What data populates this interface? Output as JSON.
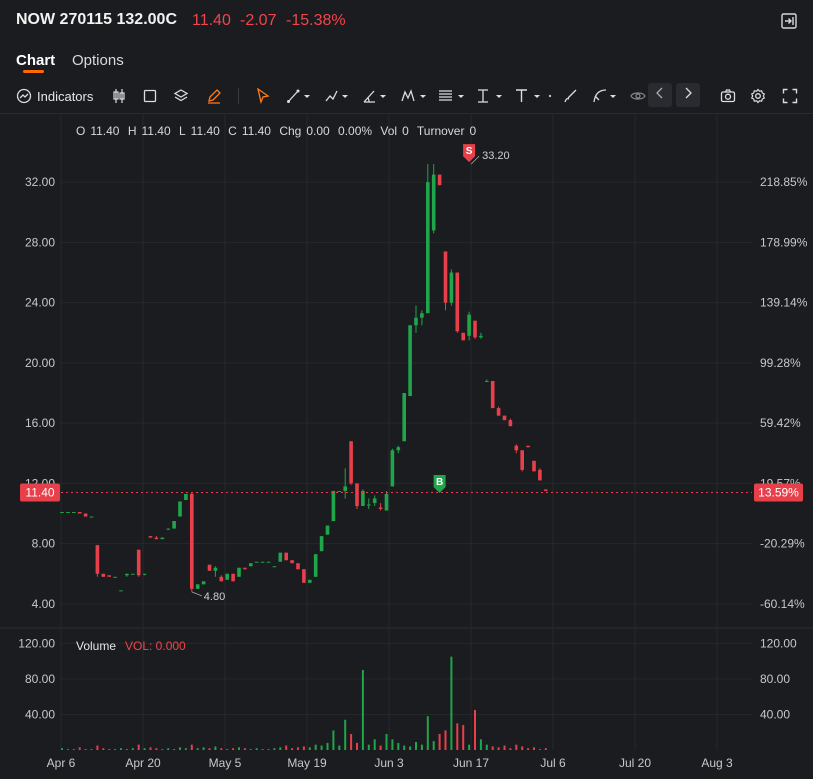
{
  "header": {
    "symbol": "NOW 270115 132.00C",
    "last_price": "11.40",
    "change": "-2.07",
    "change_pct": "-15.38%",
    "exit_icon": "exit-fullscreen-icon"
  },
  "tabs": [
    {
      "label": "Chart",
      "active": true
    },
    {
      "label": "Options",
      "active": false
    }
  ],
  "toolbar": {
    "indicators_label": "Indicators",
    "icons": [
      "indicators-icon",
      "candlestick-type-icon",
      "rectangle-icon",
      "layers-icon",
      "pencil-icon",
      "cursor-icon",
      "trend-line-icon",
      "multi-point-line-icon",
      "angle-icon",
      "pattern-icon",
      "horizontal-lines-icon",
      "vertical-measure-icon",
      "text-tool-icon",
      "brush-icon",
      "path-tool-icon",
      "visibility-icon",
      "chevron-left-icon",
      "chevron-right-icon",
      "camera-icon",
      "settings-icon",
      "fullscreen-icon"
    ]
  },
  "ohlc": {
    "open_label": "O",
    "open": "11.40",
    "high_label": "H",
    "high": "11.40",
    "low_label": "L",
    "low": "11.40",
    "close_label": "C",
    "close": "11.40",
    "chg_label": "Chg",
    "chg": "0.00",
    "chg_pct": "0.00%",
    "vol_label": "Vol",
    "vol": "0",
    "turnover_label": "Turnover",
    "turnover": "0"
  },
  "chart_data": {
    "type": "candlestick",
    "colors": {
      "up": "#1fa54a",
      "down": "#e8404a",
      "last_price": "#e8404a",
      "marker_sell": "#e8404a",
      "marker_buy": "#1fa54a"
    },
    "y_left_ticks": [
      "4.00",
      "8.00",
      "12.00",
      "16.00",
      "20.00",
      "24.00",
      "28.00",
      "32.00"
    ],
    "y_right_ticks": [
      "-60.14%",
      "-20.29%",
      "19.57%",
      "59.42%",
      "99.28%",
      "139.14%",
      "178.99%",
      "218.85%"
    ],
    "ylim": [
      2.4,
      34.8
    ],
    "x_ticks": [
      "Apr 6",
      "Apr 20",
      "May 5",
      "May 19",
      "Jun 3",
      "Jun 17",
      "Jul 6",
      "Jul 20",
      "Aug 3"
    ],
    "last_price_label": "11.40",
    "last_price_pct": "13.59%",
    "high_annotation": "33.20",
    "low_annotation": "4.80",
    "markers": [
      {
        "type": "S",
        "date_index": 69,
        "price": 33.2
      },
      {
        "type": "B",
        "date_index": 64,
        "price": 11.5
      }
    ],
    "volume_label": "Volume",
    "volume_value": "VOL: 0.000",
    "volume_ticks": [
      "40.00",
      "80.00",
      "120.00"
    ],
    "volume_ylim": [
      0,
      135
    ],
    "candles": [
      [
        10.1,
        10.1,
        10.1,
        10.1
      ],
      [
        10.1,
        10.1,
        10.1,
        10.1
      ],
      [
        10.1,
        10.1,
        10.1,
        10.1
      ],
      [
        10.1,
        10.1,
        10.1,
        10.0
      ],
      [
        10.0,
        10.0,
        9.8,
        9.8
      ],
      [
        9.8,
        9.8,
        9.8,
        9.8
      ],
      [
        7.9,
        7.9,
        5.8,
        6.0
      ],
      [
        6.0,
        6.0,
        5.8,
        5.8
      ],
      [
        5.9,
        5.9,
        5.8,
        5.8
      ],
      [
        5.8,
        5.8,
        5.8,
        5.8
      ],
      [
        4.9,
        4.9,
        4.9,
        4.9
      ],
      [
        5.9,
        6.0,
        5.8,
        6.0
      ],
      [
        6.0,
        6.0,
        6.0,
        6.0
      ],
      [
        7.6,
        7.6,
        5.8,
        5.9
      ],
      [
        6.0,
        6.0,
        5.9,
        6.0
      ],
      [
        8.5,
        8.5,
        8.4,
        8.4
      ],
      [
        8.4,
        8.5,
        8.3,
        8.3
      ],
      [
        8.3,
        8.4,
        8.3,
        8.4
      ],
      [
        9.0,
        9.0,
        8.9,
        9.0
      ],
      [
        9.0,
        9.5,
        9.0,
        9.5
      ],
      [
        9.8,
        10.8,
        9.8,
        10.8
      ],
      [
        10.9,
        11.3,
        10.9,
        11.3
      ],
      [
        11.3,
        11.4,
        4.8,
        5.0
      ],
      [
        5.0,
        5.3,
        5.0,
        5.3
      ],
      [
        5.3,
        5.5,
        5.3,
        5.5
      ],
      [
        6.6,
        6.6,
        6.2,
        6.2
      ],
      [
        6.2,
        6.5,
        5.8,
        6.4
      ],
      [
        5.8,
        5.9,
        5.5,
        5.5
      ],
      [
        5.6,
        6.0,
        5.6,
        6.0
      ],
      [
        6.0,
        6.0,
        5.5,
        5.5
      ],
      [
        5.8,
        6.4,
        5.8,
        6.4
      ],
      [
        6.4,
        6.4,
        6.3,
        6.3
      ],
      [
        6.5,
        6.7,
        6.5,
        6.7
      ],
      [
        6.8,
        6.8,
        6.8,
        6.8
      ],
      [
        6.8,
        6.8,
        6.8,
        6.8
      ],
      [
        6.8,
        6.8,
        6.8,
        6.8
      ],
      [
        6.5,
        6.5,
        6.5,
        6.5
      ],
      [
        6.8,
        7.4,
        6.8,
        7.4
      ],
      [
        7.4,
        7.4,
        6.9,
        6.9
      ],
      [
        6.9,
        6.9,
        6.7,
        6.7
      ],
      [
        6.7,
        6.7,
        6.3,
        6.3
      ],
      [
        6.3,
        6.3,
        5.4,
        5.4
      ],
      [
        5.4,
        5.6,
        5.4,
        5.6
      ],
      [
        5.8,
        7.3,
        5.8,
        7.3
      ],
      [
        7.5,
        8.5,
        7.5,
        8.5
      ],
      [
        8.6,
        9.2,
        8.6,
        9.2
      ],
      [
        9.5,
        11.5,
        9.5,
        11.5
      ],
      [
        11.5,
        11.5,
        11.5,
        11.5
      ],
      [
        11.5,
        13.0,
        11.0,
        11.8
      ],
      [
        14.8,
        14.8,
        11.9,
        12.0
      ],
      [
        12.0,
        12.0,
        10.3,
        10.5
      ],
      [
        10.5,
        11.6,
        10.5,
        11.5
      ],
      [
        10.6,
        11.0,
        10.3,
        10.6
      ],
      [
        10.7,
        11.2,
        10.5,
        11.0
      ],
      [
        10.4,
        10.7,
        10.2,
        10.3
      ],
      [
        10.2,
        11.5,
        10.2,
        11.3
      ],
      [
        11.8,
        14.3,
        11.8,
        14.2
      ],
      [
        14.2,
        14.5,
        14.0,
        14.4
      ],
      [
        14.8,
        18.0,
        14.8,
        18.0
      ],
      [
        17.8,
        22.5,
        17.8,
        22.5
      ],
      [
        22.5,
        23.8,
        22.0,
        23.0
      ],
      [
        23.0,
        23.5,
        22.5,
        23.3
      ],
      [
        23.3,
        33.2,
        28.8,
        32.0
      ],
      [
        28.8,
        33.2,
        28.6,
        32.5
      ],
      [
        32.5,
        32.5,
        31.8,
        31.8
      ],
      [
        27.4,
        27.4,
        23.5,
        24.0
      ],
      [
        24.0,
        26.2,
        23.8,
        26.0
      ],
      [
        26.0,
        26.0,
        22.0,
        22.1
      ],
      [
        22.0,
        22.0,
        21.5,
        21.5
      ],
      [
        21.8,
        23.4,
        21.5,
        23.2
      ],
      [
        22.8,
        22.8,
        21.6,
        21.7
      ],
      [
        21.7,
        22.0,
        21.6,
        21.8
      ],
      [
        18.8,
        18.9,
        18.8,
        18.8
      ],
      [
        18.8,
        18.8,
        17.0,
        17.0
      ],
      [
        17.0,
        17.1,
        16.5,
        16.5
      ],
      [
        16.5,
        16.5,
        16.2,
        16.2
      ],
      [
        16.2,
        16.3,
        15.8,
        15.8
      ],
      [
        14.5,
        14.6,
        14.0,
        14.2
      ],
      [
        14.2,
        14.2,
        12.8,
        12.9
      ],
      [
        14.5,
        14.5,
        14.4,
        14.4
      ],
      [
        13.5,
        13.5,
        12.8,
        12.8
      ],
      [
        12.9,
        13.0,
        12.2,
        12.2
      ],
      [
        11.6,
        11.6,
        11.5,
        11.5
      ]
    ],
    "volumes": [
      2,
      1,
      1,
      3,
      1,
      1,
      5,
      2,
      1,
      1,
      2,
      1,
      2,
      6,
      2,
      3,
      2,
      1,
      2,
      1,
      3,
      2,
      6,
      2,
      3,
      2,
      4,
      2,
      1,
      2,
      3,
      2,
      1,
      2,
      1,
      1,
      2,
      3,
      5,
      2,
      3,
      4,
      3,
      6,
      5,
      8,
      22,
      5,
      34,
      18,
      8,
      90,
      6,
      12,
      5,
      18,
      12,
      8,
      5,
      4,
      9,
      6,
      38,
      10,
      18,
      22,
      105,
      30,
      28,
      6,
      45,
      12,
      6,
      4,
      3,
      5,
      2,
      6,
      4,
      2,
      3,
      1,
      2
    ]
  }
}
